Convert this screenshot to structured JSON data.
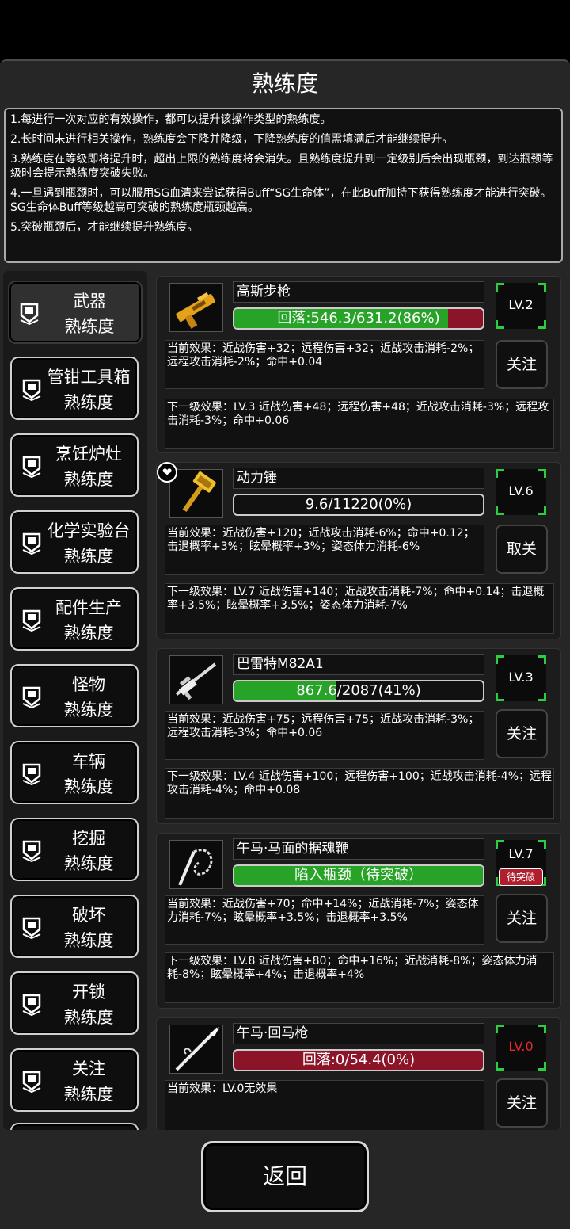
{
  "page": {
    "title": "熟练度"
  },
  "rules": [
    "1.每进行一次对应的有效操作，都可以提升该操作类型的熟练度。",
    "2.长时间未进行相关操作，熟练度会下降并降级，下降熟练度的值需填满后才能继续提升。",
    "3.熟练度在等级即将提升时，超出上限的熟练度将会消失。且熟练度提升到一定级别后会出现瓶颈，到达瓶颈等级时会提示熟练度突破失败。",
    "4.一旦遇到瓶颈时，可以服用SG血清来尝试获得Buff“SG生命体”，在此Buff加持下获得熟练度才能进行突破。SG生命体Buff等级越高可突破的熟练度瓶颈越高。",
    "5.突破瓶颈后，才能继续提升熟练度。"
  ],
  "categories": [
    {
      "line1": "武器",
      "line2": "熟练度",
      "active": true
    },
    {
      "line1": "管钳工具箱",
      "line2": "熟练度"
    },
    {
      "line1": "烹饪炉灶",
      "line2": "熟练度"
    },
    {
      "line1": "化学实验台",
      "line2": "熟练度"
    },
    {
      "line1": "配件生产",
      "line2": "熟练度"
    },
    {
      "line1": "怪物",
      "line2": "熟练度"
    },
    {
      "line1": "车辆",
      "line2": "熟练度"
    },
    {
      "line1": "挖掘",
      "line2": "熟练度"
    },
    {
      "line1": "破坏",
      "line2": "熟练度"
    },
    {
      "line1": "开锁",
      "line2": "熟练度"
    },
    {
      "line1": "关注",
      "line2": "熟练度"
    }
  ],
  "items": [
    {
      "name": "高斯步枪",
      "progress_text": "回落:546.3/631.2(86%)",
      "progress": 0.86,
      "bar_color": "#27a327",
      "bar_bg": "#8c1428",
      "level": "LV.2",
      "level_color": "#ffffff",
      "corner_color": "#2ecc40",
      "current_effect": "当前效果：近战伤害+32；远程伤害+32；近战攻击消耗-2%；远程攻击消耗-2%；命中+0.04",
      "button": "关注",
      "next_effect": "下一级效果：LV.3 近战伤害+48；远程伤害+48；近战攻击消耗-3%；远程攻击消耗-3%；命中+0.06",
      "icon": "gauss-rifle-icon"
    },
    {
      "name": "动力锤",
      "progress_text": "9.6/11220(0%)",
      "progress": 0.0,
      "bar_color": "#27a327",
      "bar_bg": "#111111",
      "level": "LV.6",
      "level_color": "#ffffff",
      "corner_color": "#2ecc40",
      "current_effect": "当前效果：近战伤害+120；近战攻击消耗-6%；命中+0.12；击退概率+3%；眩晕概率+3%；姿态体力消耗-6%",
      "button": "取关",
      "next_effect": "下一级效果：LV.7 近战伤害+140；近战攻击消耗-7%；命中+0.14；击退概率+3.5%；眩晕概率+3.5%；姿态体力消耗-7%",
      "favorite_icon": "heart-icon",
      "icon": "power-hammer-icon"
    },
    {
      "name": "巴雷特M82A1",
      "progress_text": "867.6/2087(41%)",
      "progress": 0.41,
      "bar_color": "#27a327",
      "bar_bg": "#111111",
      "level": "LV.3",
      "level_color": "#ffffff",
      "corner_color": "#2ecc40",
      "current_effect": "当前效果：近战伤害+75；远程伤害+75；近战攻击消耗-3%；远程攻击消耗-3%；命中+0.06",
      "button": "关注",
      "next_effect": "下一级效果：LV.4 近战伤害+100；远程伤害+100；近战攻击消耗-4%；远程攻击消耗-4%；命中+0.08",
      "icon": "sniper-rifle-icon"
    },
    {
      "name": "午马·马面的据魂鞭",
      "progress_text": "陷入瓶颈（待突破）",
      "progress": 1.0,
      "bar_color": "#27a327",
      "bar_bg": "#111111",
      "level": "LV.7",
      "level_color": "#ffffff",
      "corner_color": "#2ecc40",
      "badge": "待突破",
      "current_effect": "当前效果：近战伤害+70；命中+14%；近战消耗-7%；姿态体力消耗-7%；眩晕概率+3.5%；击退概率+3.5%",
      "button": "关注",
      "next_effect": "下一级效果：LV.8 近战伤害+80；命中+16%；近战消耗-8%；姿态体力消耗-8%；眩晕概率+4%；击退概率+4%",
      "icon": "soul-whip-icon"
    },
    {
      "name": "午马·回马枪",
      "progress_text": "回落:0/54.4(0%)",
      "progress": 0.0,
      "bar_color": "#27a327",
      "bar_bg": "#8c1428",
      "level": "LV.0",
      "level_color": "#e8282b",
      "corner_color": "#2ecc40",
      "current_effect": "当前效果：LV.0无效果",
      "button": "关注",
      "next_effect": "",
      "icon": "spear-icon"
    }
  ],
  "footer": {
    "back_label": "返回"
  }
}
